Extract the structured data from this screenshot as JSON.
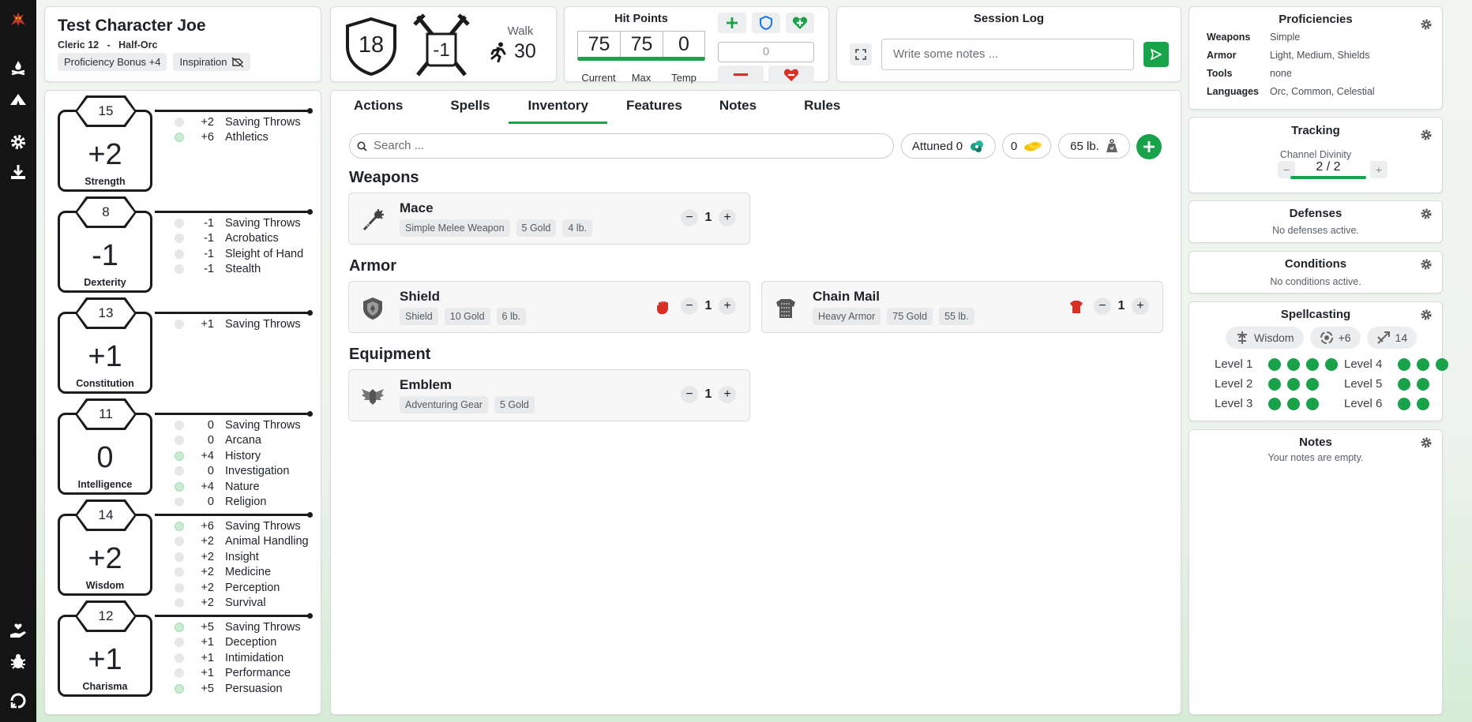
{
  "character": {
    "name": "Test Character Joe",
    "class_level": "Cleric 12",
    "separator": "-",
    "race": "Half-Orc",
    "proficiency_bonus": "Proficiency Bonus +4",
    "inspiration": "Inspiration"
  },
  "combat": {
    "armor_class": "18",
    "initiative": "-1",
    "speed_label": "Walk",
    "speed_value": "30"
  },
  "hit_points": {
    "title": "Hit Points",
    "current": "75",
    "max": "75",
    "temp": "0",
    "current_label": "Current",
    "max_label": "Max",
    "temp_label": "Temp",
    "input_value": "0",
    "fill_fraction": 1.0
  },
  "session_log": {
    "title": "Session Log",
    "placeholder": "Write some notes ..."
  },
  "abilities": [
    {
      "score": "15",
      "mod": "+2",
      "name": "Strength",
      "skills": [
        {
          "val": "+2",
          "name": "Saving Throws",
          "prof": false
        },
        {
          "val": "+6",
          "name": "Athletics",
          "prof": true
        }
      ]
    },
    {
      "score": "8",
      "mod": "-1",
      "name": "Dexterity",
      "skills": [
        {
          "val": "-1",
          "name": "Saving Throws",
          "prof": false
        },
        {
          "val": "-1",
          "name": "Acrobatics",
          "prof": false
        },
        {
          "val": "-1",
          "name": "Sleight of Hand",
          "prof": false
        },
        {
          "val": "-1",
          "name": "Stealth",
          "prof": false
        }
      ]
    },
    {
      "score": "13",
      "mod": "+1",
      "name": "Constitution",
      "skills": [
        {
          "val": "+1",
          "name": "Saving Throws",
          "prof": false
        }
      ]
    },
    {
      "score": "11",
      "mod": "0",
      "name": "Intelligence",
      "skills": [
        {
          "val": "0",
          "name": "Saving Throws",
          "prof": false
        },
        {
          "val": "0",
          "name": "Arcana",
          "prof": false
        },
        {
          "val": "+4",
          "name": "History",
          "prof": true
        },
        {
          "val": "0",
          "name": "Investigation",
          "prof": false
        },
        {
          "val": "+4",
          "name": "Nature",
          "prof": true
        },
        {
          "val": "0",
          "name": "Religion",
          "prof": false
        }
      ]
    },
    {
      "score": "14",
      "mod": "+2",
      "name": "Wisdom",
      "skills": [
        {
          "val": "+6",
          "name": "Saving Throws",
          "prof": true
        },
        {
          "val": "+2",
          "name": "Animal Handling",
          "prof": false
        },
        {
          "val": "+2",
          "name": "Insight",
          "prof": false
        },
        {
          "val": "+2",
          "name": "Medicine",
          "prof": false
        },
        {
          "val": "+2",
          "name": "Perception",
          "prof": false
        },
        {
          "val": "+2",
          "name": "Survival",
          "prof": false
        }
      ]
    },
    {
      "score": "12",
      "mod": "+1",
      "name": "Charisma",
      "skills": [
        {
          "val": "+5",
          "name": "Saving Throws",
          "prof": true
        },
        {
          "val": "+1",
          "name": "Deception",
          "prof": false
        },
        {
          "val": "+1",
          "name": "Intimidation",
          "prof": false
        },
        {
          "val": "+1",
          "name": "Performance",
          "prof": false
        },
        {
          "val": "+5",
          "name": "Persuasion",
          "prof": true
        }
      ]
    }
  ],
  "tabs": [
    "Actions",
    "Spells",
    "Inventory",
    "Features",
    "Notes",
    "Rules"
  ],
  "active_tab": "Inventory",
  "inventory": {
    "search_placeholder": "Search ...",
    "attuned": "Attuned 0",
    "gold": "0",
    "weight": "65 lb.",
    "sections": {
      "weapons": "Weapons",
      "armor": "Armor",
      "equipment": "Equipment"
    },
    "items": {
      "mace": {
        "name": "Mace",
        "tags": [
          "Simple Melee Weapon",
          "5 Gold",
          "4 lb."
        ],
        "qty": "1"
      },
      "shield": {
        "name": "Shield",
        "tags": [
          "Shield",
          "10 Gold",
          "6 lb."
        ],
        "qty": "1"
      },
      "chain_mail": {
        "name": "Chain Mail",
        "tags": [
          "Heavy Armor",
          "75 Gold",
          "55 lb."
        ],
        "qty": "1"
      },
      "emblem": {
        "name": "Emblem",
        "tags": [
          "Adventuring Gear",
          "5 Gold"
        ],
        "qty": "1"
      }
    }
  },
  "proficiencies": {
    "title": "Proficiencies",
    "rows": [
      {
        "k": "Weapons",
        "v": "Simple"
      },
      {
        "k": "Armor",
        "v": "Light, Medium, Shields"
      },
      {
        "k": "Tools",
        "v": "none"
      },
      {
        "k": "Languages",
        "v": "Orc, Common, Celestial"
      }
    ]
  },
  "tracking": {
    "title": "Tracking",
    "label": "Channel Divinity",
    "value": "2 / 2",
    "minus": "−",
    "plus": "+"
  },
  "defenses": {
    "title": "Defenses",
    "text": "No defenses active."
  },
  "conditions": {
    "title": "Conditions",
    "text": "No conditions active."
  },
  "spellcasting": {
    "title": "Spellcasting",
    "ability": "Wisdom",
    "attack": "+6",
    "dc": "14",
    "levels": [
      {
        "label": "Level 1",
        "slots": 4
      },
      {
        "label": "Level 2",
        "slots": 3
      },
      {
        "label": "Level 3",
        "slots": 3
      },
      {
        "label": "Level 4",
        "slots": 3
      },
      {
        "label": "Level 5",
        "slots": 2
      },
      {
        "label": "Level 6",
        "slots": 2
      }
    ]
  },
  "notes": {
    "title": "Notes",
    "text": "Your notes are empty."
  },
  "colors": {
    "accent": "#18a34a",
    "rail": "#141414",
    "danger": "#d93025",
    "shield_blue": "#1a73e8"
  }
}
